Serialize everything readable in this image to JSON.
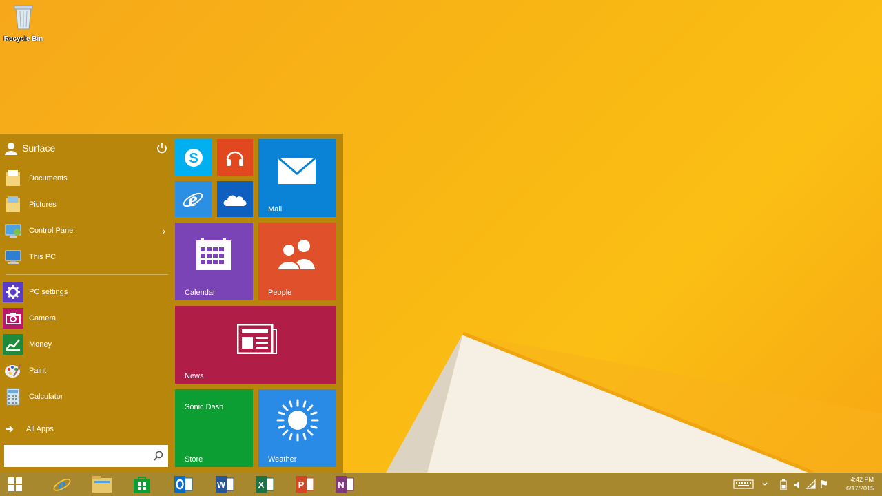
{
  "desktop": {
    "recycle_bin_label": "Recycle Bin"
  },
  "start_menu": {
    "user_name": "Surface",
    "items": [
      {
        "label": "Documents",
        "icon": "folder-documents-icon"
      },
      {
        "label": "Pictures",
        "icon": "folder-pictures-icon"
      },
      {
        "label": "Control Panel",
        "icon": "control-panel-icon",
        "has_arrow": true
      },
      {
        "label": "This PC",
        "icon": "computer-icon"
      },
      {
        "label": "PC settings",
        "icon": "gear-icon"
      },
      {
        "label": "Camera",
        "icon": "camera-icon"
      },
      {
        "label": "Money",
        "icon": "money-chart-icon"
      },
      {
        "label": "Paint",
        "icon": "paint-palette-icon"
      },
      {
        "label": "Calculator",
        "icon": "calculator-icon"
      }
    ],
    "all_apps_label": "All Apps",
    "arrow_glyph": "›",
    "search_placeholder": ""
  },
  "tiles": {
    "skype": {
      "label": "",
      "color": "#00aff0"
    },
    "music": {
      "label": "",
      "color": "#e1481f"
    },
    "ie": {
      "label": "",
      "color": "#2b8fe4"
    },
    "onedrive": {
      "label": "",
      "color": "#0f5fc0"
    },
    "mail": {
      "label": "Mail",
      "color": "#0a83d6"
    },
    "calendar": {
      "label": "Calendar",
      "color": "#7a43b6"
    },
    "people": {
      "label": "People",
      "color": "#e0512b"
    },
    "news": {
      "label": "News",
      "color": "#b01e48"
    },
    "store": {
      "label": "Store",
      "app_title": "Sonic Dash",
      "color": "#0d9e33"
    },
    "weather": {
      "label": "Weather",
      "color": "#2a8be6"
    }
  },
  "taskbar": {
    "clock_time": "4:42 PM",
    "clock_date": "6/17/2015"
  }
}
